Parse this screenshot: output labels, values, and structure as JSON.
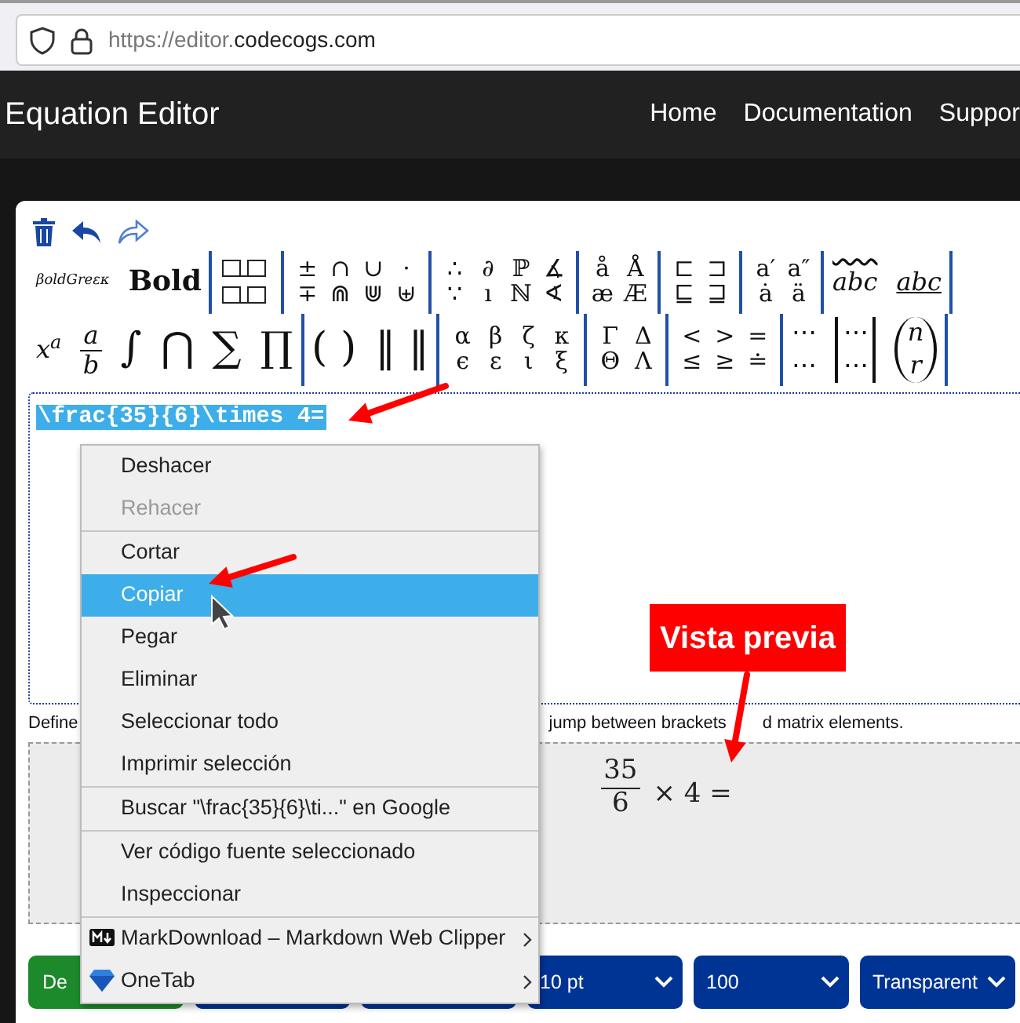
{
  "browser": {
    "url_prefix": "https://editor.",
    "url_domain": "codecogs.com"
  },
  "navbar": {
    "brand": "Equation Editor",
    "links": [
      "Home",
      "Documentation",
      "Suppor"
    ]
  },
  "toolbar": {
    "top_groups": [
      {
        "kind": "inline",
        "items": [
          {
            "kind": "tiny",
            "text": "βoldGreεκ"
          },
          {
            "kind": "bold",
            "text": "Bold"
          }
        ]
      },
      {
        "kind": "boxes"
      },
      {
        "kind": "grid",
        "items": [
          "±",
          "∩",
          "∪",
          "·",
          "∓",
          "⋒",
          "⋓",
          "⊎"
        ]
      },
      {
        "kind": "grid",
        "items": [
          "∴",
          "∂",
          "ℙ",
          "∡",
          "∵",
          "ı",
          "ℕ",
          "∢"
        ]
      },
      {
        "kind": "grid",
        "items": [
          "å",
          "Å",
          "æ",
          "Æ"
        ]
      },
      {
        "kind": "grid",
        "items": [
          "⊏",
          "⊐",
          "⊑",
          "⊒"
        ]
      },
      {
        "kind": "grid",
        "items": [
          "a′",
          "a″",
          "ȧ",
          "ä"
        ]
      },
      {
        "kind": "inline",
        "items": [
          {
            "kind": "wide",
            "text": "abc"
          },
          {
            "kind": "under",
            "text": "abc"
          }
        ]
      }
    ],
    "bottom_groups": [
      {
        "kind": "inline",
        "items": [
          {
            "kind": "sup",
            "text": "x$^{a}$"
          },
          {
            "kind": "frac",
            "num": "a",
            "den": "b"
          },
          {
            "kind": "big",
            "text": "∫"
          },
          {
            "kind": "big",
            "text": "⋂"
          },
          {
            "kind": "big",
            "text": "∑"
          },
          {
            "kind": "big",
            "text": "∏"
          }
        ]
      },
      {
        "kind": "inline",
        "items": [
          {
            "kind": "big",
            "text": "( )"
          },
          {
            "kind": "big",
            "text": "‖ ‖"
          }
        ]
      },
      {
        "kind": "grid",
        "items": [
          "α",
          "β",
          "ζ",
          "κ",
          "ϵ",
          "ε",
          "ι",
          "ξ"
        ]
      },
      {
        "kind": "grid",
        "items": [
          "Γ",
          "Δ",
          "Θ",
          "Λ"
        ]
      },
      {
        "kind": "grid",
        "items": [
          "<",
          ">",
          "=",
          "≤",
          "≥",
          "≐"
        ]
      },
      {
        "kind": "inline",
        "items": [
          {
            "kind": "stack",
            "top": "⋯",
            "bottom": "⋯"
          },
          {
            "kind": "matrix",
            "top": "⋯",
            "bottom": "⋯"
          },
          {
            "kind": "binom",
            "top": "n",
            "bottom": "r"
          }
        ]
      }
    ]
  },
  "editor": {
    "text": "\\frac{35}{6}\\times 4=",
    "selected": true
  },
  "help": [
    "Define",
    "jump between brackets",
    "d matrix elements."
  ],
  "preview": {
    "numerator": "35",
    "denominator": "6",
    "rest": "× 4 ="
  },
  "buttons": [
    {
      "kind": "green",
      "label": "De"
    },
    {
      "kind": "select"
    },
    {
      "kind": "select"
    },
    {
      "kind": "select",
      "label": "10 pt"
    },
    {
      "kind": "select",
      "label": "100"
    },
    {
      "kind": "select",
      "label": "Transparent"
    }
  ],
  "context_menu": {
    "items": [
      {
        "kind": "item",
        "label": "Deshacer",
        "disabled": false,
        "selected": false
      },
      {
        "kind": "item",
        "label": "Rehacer",
        "disabled": true,
        "selected": false
      },
      {
        "kind": "separator"
      },
      {
        "kind": "item",
        "label": "Cortar",
        "disabled": false,
        "selected": false
      },
      {
        "kind": "item",
        "label": "Copiar",
        "disabled": false,
        "selected": true
      },
      {
        "kind": "item",
        "label": "Pegar",
        "disabled": false,
        "selected": false
      },
      {
        "kind": "item",
        "label": "Eliminar",
        "disabled": false,
        "selected": false
      },
      {
        "kind": "item",
        "label": "Seleccionar todo",
        "disabled": false,
        "selected": false
      },
      {
        "kind": "item",
        "label": "Imprimir selección",
        "disabled": false,
        "selected": false
      },
      {
        "kind": "separator"
      },
      {
        "kind": "item",
        "label": "Buscar \"\\frac{35}{6}\\ti...\" en Google",
        "disabled": false,
        "selected": false
      },
      {
        "kind": "separator"
      },
      {
        "kind": "item",
        "label": "Ver código fuente seleccionado",
        "disabled": false,
        "selected": false
      },
      {
        "kind": "item",
        "label": "Inspeccionar",
        "disabled": false,
        "selected": false
      },
      {
        "kind": "separator"
      },
      {
        "kind": "submenu",
        "label": "MarkDownload – Markdown Web Clipper",
        "disabled": false,
        "selected": false
      },
      {
        "kind": "submenu",
        "label": "OneTab",
        "disabled": false,
        "selected": false
      }
    ]
  },
  "annotation": {
    "callout": "Vista previa"
  }
}
